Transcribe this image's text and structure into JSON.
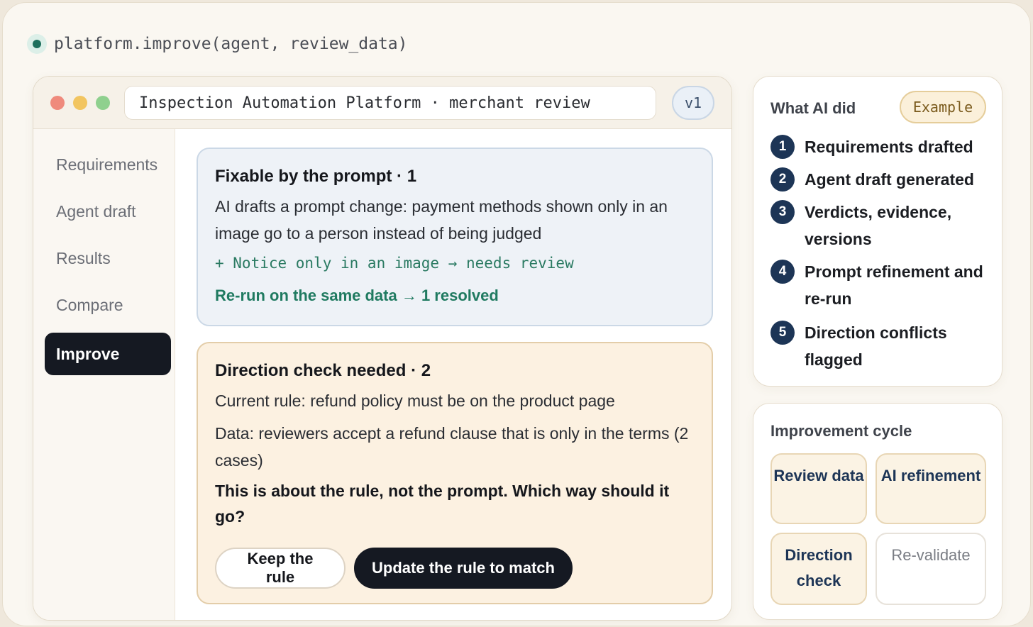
{
  "command": "platform.improve(agent, review_data)",
  "window": {
    "address": "Inspection Automation Platform · merchant review",
    "version": "v1"
  },
  "sidebar": {
    "items": [
      {
        "label": "Requirements"
      },
      {
        "label": "Agent draft"
      },
      {
        "label": "Results"
      },
      {
        "label": "Compare"
      },
      {
        "label": "Improve",
        "active": true
      }
    ]
  },
  "fixable": {
    "title": "Fixable by the prompt · 1",
    "body": "AI drafts a prompt change: payment methods shown only in an image go to a person instead of being judged",
    "diff": "+ Notice only in an image → needs review",
    "result": "Re-run on the same data → 1 resolved"
  },
  "direction": {
    "title": "Direction check needed · 2",
    "current_rule": "Current rule: refund policy must be on the product page",
    "data_note": "Data: reviewers accept a refund clause that is only in the terms (2 cases)",
    "question": "This is about the rule, not the prompt. Which way should it go?",
    "keep_label": "Keep the rule",
    "update_label": "Update the rule to match"
  },
  "what_ai_did": {
    "heading": "What AI did",
    "badge": "Example",
    "steps": [
      {
        "num": "1",
        "label": "Requirements drafted"
      },
      {
        "num": "2",
        "label": "Agent draft generated"
      },
      {
        "num": "3",
        "label": "Verdicts, evidence, versions"
      },
      {
        "num": "4",
        "label": "Prompt refinement and re-run"
      },
      {
        "num": "5",
        "label": "Direction conflicts flagged"
      }
    ]
  },
  "cycle": {
    "heading": "Improvement cycle",
    "tiles": [
      {
        "label": "Review data",
        "state": "done"
      },
      {
        "label": "AI refinement",
        "state": "done"
      },
      {
        "label": "Direction check",
        "state": "done"
      },
      {
        "label": "Re-validate",
        "state": "pending"
      }
    ]
  },
  "colors": {
    "accent_dark": "#151922",
    "step_badge": "#1d3556",
    "success_green": "#1f7a60",
    "fix_card_bg": "#eef2f7",
    "direction_card_bg": "#fcf1e1"
  }
}
